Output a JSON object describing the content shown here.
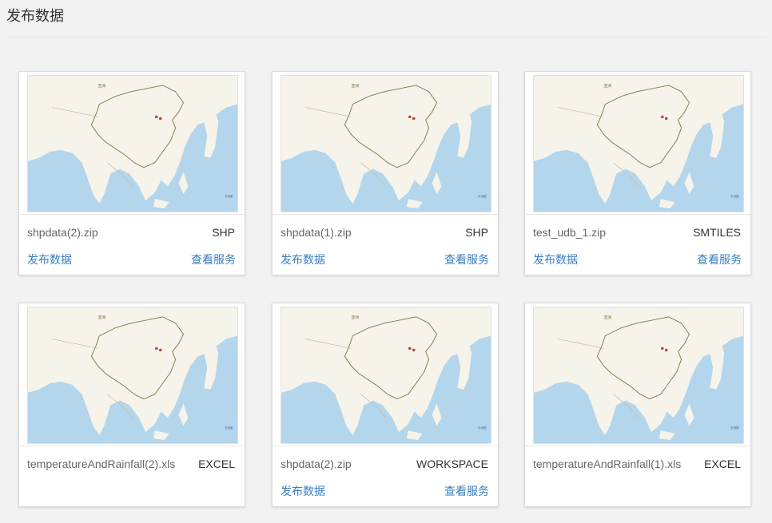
{
  "page": {
    "title": "发布数据"
  },
  "map": {
    "region_label": "亚洲",
    "corner_label": "天地图"
  },
  "cards": [
    {
      "name": "shpdata(2).zip",
      "type": "SHP",
      "publish_label": "发布数据",
      "view_label": "查看服务"
    },
    {
      "name": "shpdata(1).zip",
      "type": "SHP",
      "publish_label": "发布数据",
      "view_label": "查看服务"
    },
    {
      "name": "test_udb_1.zip",
      "type": "SMTILES",
      "publish_label": "发布数据",
      "view_label": "查看服务"
    },
    {
      "name": "temperatureAndRainfall(2).xls",
      "type": "EXCEL"
    },
    {
      "name": "shpdata(2).zip",
      "type": "WORKSPACE",
      "publish_label": "发布数据",
      "view_label": "查看服务"
    },
    {
      "name": "temperatureAndRainfall(1).xls",
      "type": "EXCEL"
    }
  ],
  "colors": {
    "background": "#f2f2f2",
    "link": "#3a7ebf",
    "water": "#b3d6ec",
    "land": "#f6f3ea",
    "border": "#8c7a55"
  }
}
